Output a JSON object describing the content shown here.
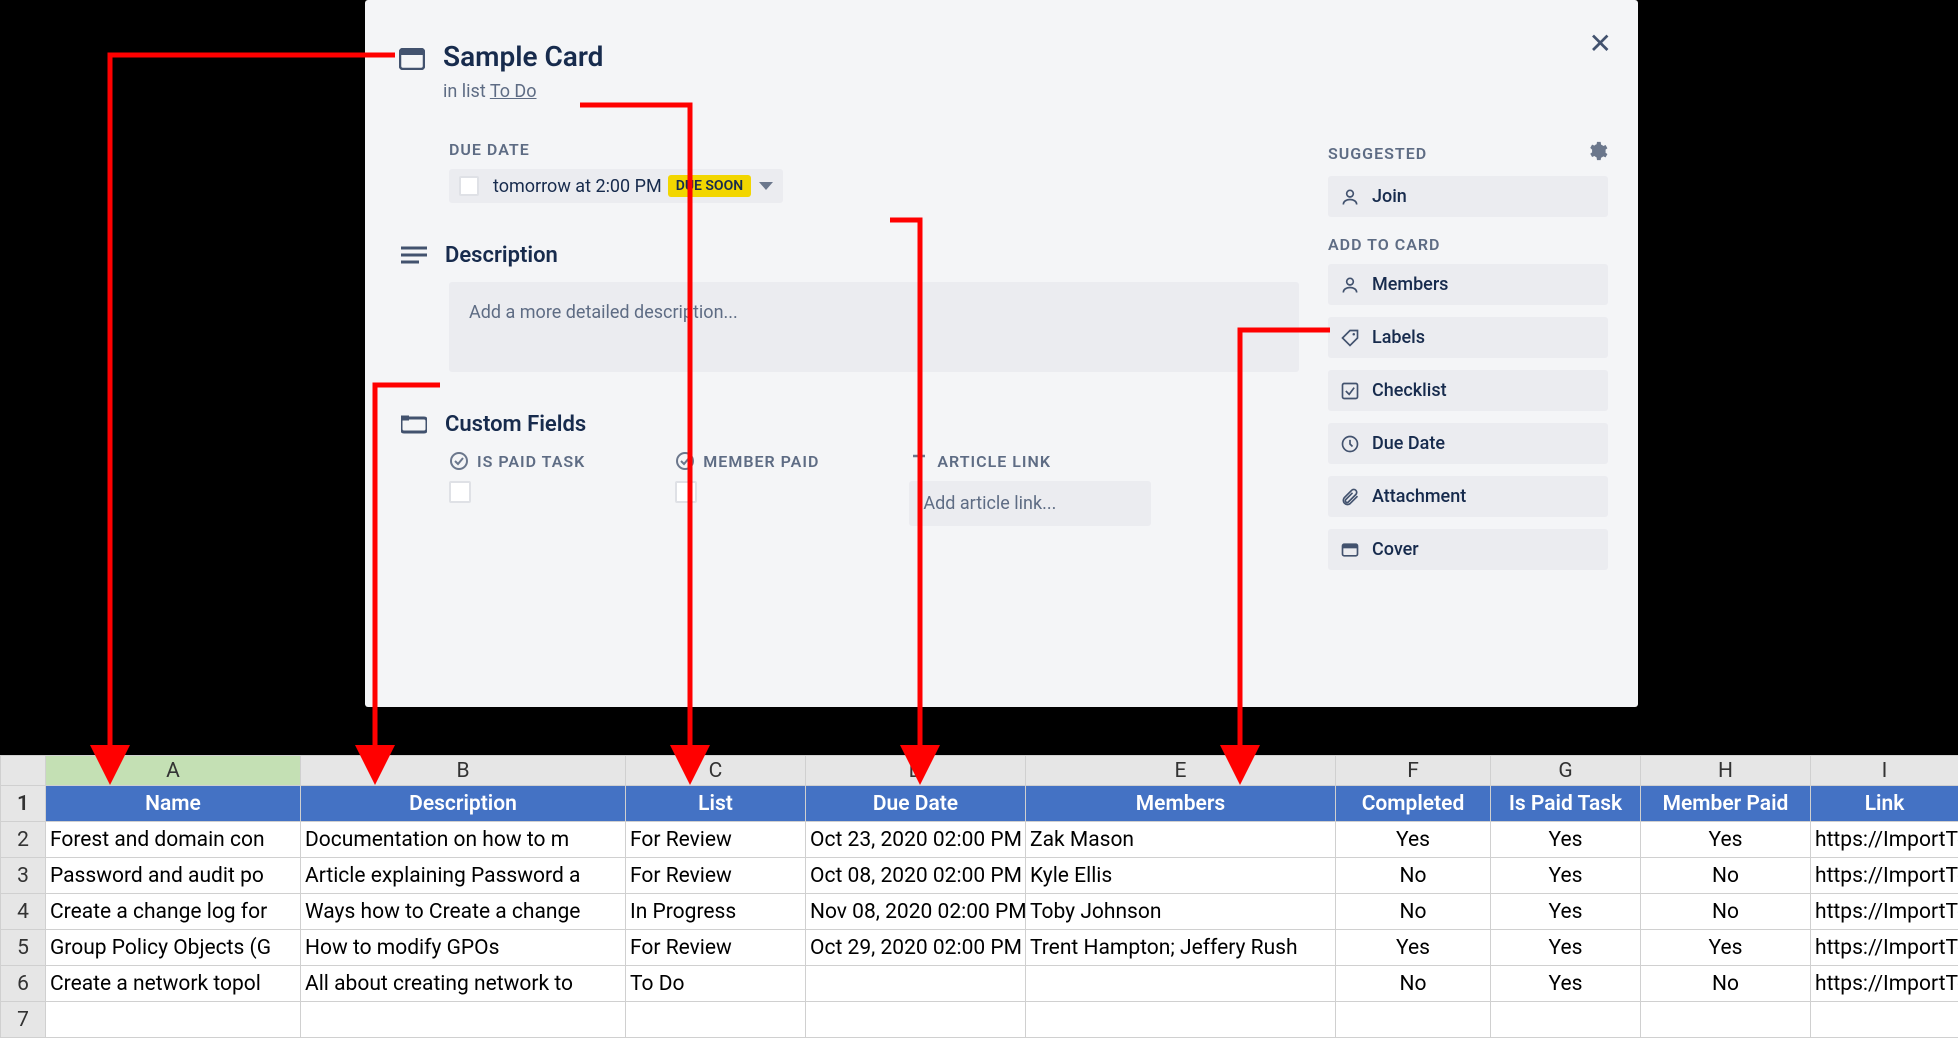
{
  "card": {
    "title": "Sample Card",
    "in_list_prefix": "in list ",
    "list_name": "To Do",
    "due_date_label": "DUE DATE",
    "due_value": "tomorrow at 2:00 PM",
    "due_tag": "DUE SOON",
    "description_heading": "Description",
    "description_placeholder": "Add a more detailed description...",
    "custom_fields_heading": "Custom Fields",
    "cf_is_paid": "IS PAID TASK",
    "cf_member_paid": "MEMBER PAID",
    "cf_article_link": "ARTICLE LINK",
    "cf_article_link_placeholder": "Add article link...",
    "suggested_label": "SUGGESTED",
    "join_label": "Join",
    "add_to_card_label": "ADD TO CARD",
    "members_label": "Members",
    "labels_label": "Labels",
    "checklist_label": "Checklist",
    "due_date_btn_label": "Due Date",
    "attachment_label": "Attachment",
    "cover_label": "Cover"
  },
  "sheet": {
    "cols": [
      "A",
      "B",
      "C",
      "D",
      "E",
      "F",
      "G",
      "H",
      "I"
    ],
    "headers": [
      "Name",
      "Description",
      "List",
      "Due Date",
      "Members",
      "Completed",
      "Is Paid Task",
      "Member Paid",
      "Link"
    ],
    "rows": [
      {
        "r": "2",
        "cells": [
          "Forest and domain con",
          "Documentation on how to m",
          "For Review",
          "Oct 23, 2020 02:00 PM",
          "Zak Mason",
          "Yes",
          "Yes",
          "Yes",
          "https://ImportTe"
        ]
      },
      {
        "r": "3",
        "cells": [
          "Password and audit po",
          "Article explaining Password a",
          "For Review",
          "Oct 08, 2020 02:00 PM",
          "Kyle Ellis",
          "No",
          "Yes",
          "No",
          "https://ImportTe"
        ]
      },
      {
        "r": "4",
        "cells": [
          "Create a change log for",
          "Ways how to Create a change",
          "In Progress",
          "Nov 08, 2020 02:00 PM",
          "Toby Johnson",
          "No",
          "Yes",
          "No",
          "https://ImportTe"
        ]
      },
      {
        "r": "5",
        "cells": [
          "Group Policy Objects (G",
          "How to modify GPOs",
          "For Review",
          "Oct 29, 2020 02:00 PM",
          "Trent Hampton; Jeffery Rush",
          "Yes",
          "Yes",
          "Yes",
          "https://ImportTe"
        ]
      },
      {
        "r": "6",
        "cells": [
          "Create a network topol",
          "All about creating network to",
          "To Do",
          "",
          "",
          "No",
          "Yes",
          "No",
          "https://ImportTe"
        ]
      },
      {
        "r": "7",
        "cells": [
          "",
          "",
          "",
          "",
          "",
          "",
          "",
          "",
          ""
        ]
      }
    ]
  }
}
